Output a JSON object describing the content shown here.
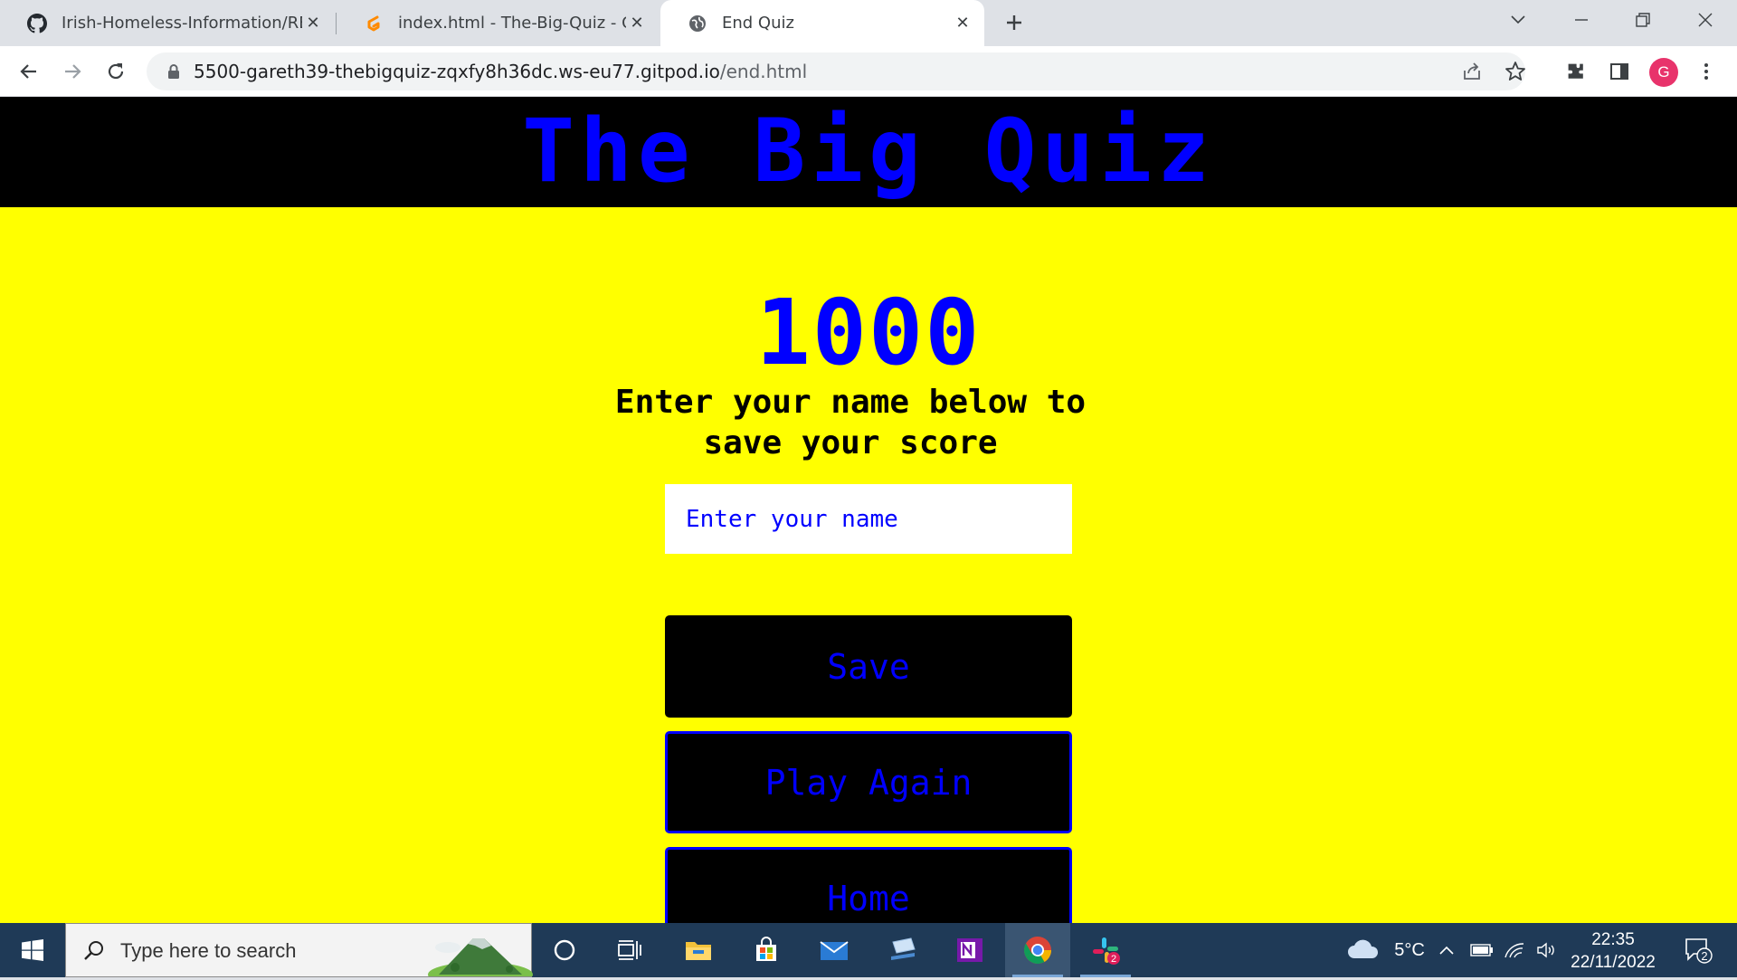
{
  "browser": {
    "tabs": [
      {
        "title": "Irish-Homeless-Information/REAI",
        "icon": "github-icon"
      },
      {
        "title": "index.html - The-Big-Quiz - Gitpo",
        "icon": "gitpod-icon"
      },
      {
        "title": "End Quiz",
        "icon": "globe-icon",
        "active": true
      }
    ],
    "url_host": "5500-gareth39-thebigquiz-zqxfy8h36dc.ws-eu77.gitpod.io",
    "url_path": "/end.html",
    "profile_initial": "G"
  },
  "page": {
    "title": "The Big Quiz",
    "score": "1000",
    "prompt": "Enter your name below to save your score",
    "name_placeholder": "Enter your name",
    "name_value": "",
    "buttons": {
      "save": "Save",
      "play_again": "Play Again",
      "home": "Home"
    },
    "colors": {
      "background": "#ffff00",
      "accent": "#0000ff",
      "header": "#000000"
    }
  },
  "taskbar": {
    "search_placeholder": "Type here to search",
    "temperature": "5°C",
    "time": "22:35",
    "date": "22/11/2022",
    "notification_count": "2",
    "slack_badge": "2",
    "apps": [
      "cortana-icon",
      "task-view-icon",
      "file-explorer-icon",
      "microsoft-store-icon",
      "mail-icon",
      "network-app-icon",
      "onenote-icon",
      "chrome-icon",
      "slack-icon"
    ]
  }
}
